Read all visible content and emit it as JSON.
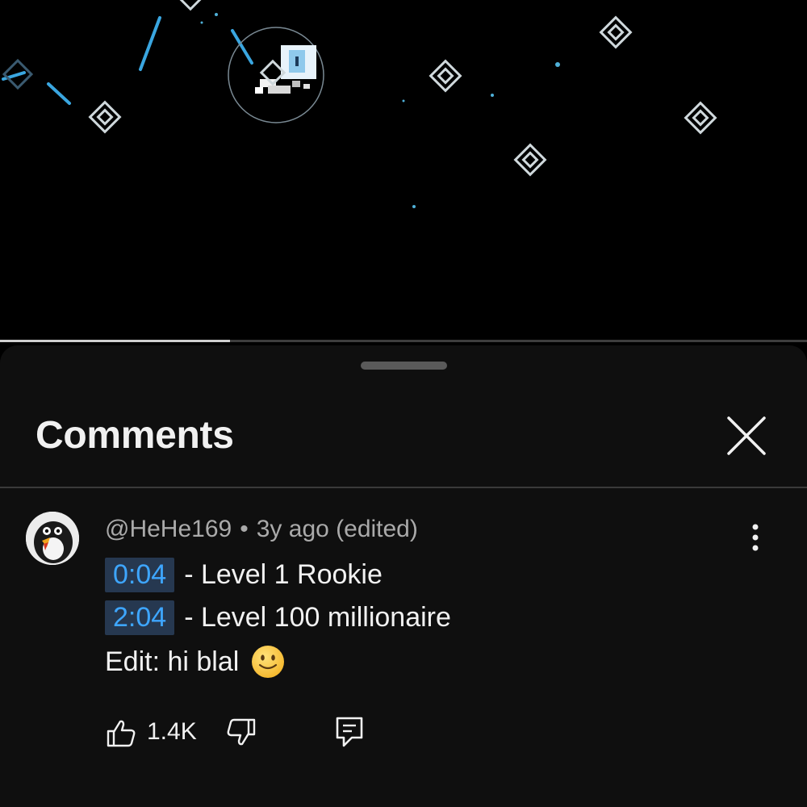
{
  "video": {
    "progress": 0.285,
    "colors": {
      "background": "#000000",
      "accent": "#3aa6e0",
      "outline": "#cfd8dc"
    }
  },
  "comments_panel": {
    "title": "Comments",
    "close_icon": "close-icon",
    "comment": {
      "author": "@HeHe169",
      "separator": "•",
      "age": "3y ago (edited)",
      "lines": [
        {
          "timestamp": "0:04",
          "text": "- Level 1 Rookie"
        },
        {
          "timestamp": "2:04",
          "text": "- Level 100 millionaire"
        }
      ],
      "edit_text": "Edit: hi blal",
      "emoji": "slightly-smiling-face",
      "likes": "1.4K",
      "icons": {
        "like": "thumbs-up-icon",
        "dislike": "thumbs-down-icon",
        "reply": "reply-icon",
        "more": "more-vertical-icon"
      }
    },
    "colors": {
      "sheet": "#0f0f0f",
      "timestamp_link": "#3ea6ff",
      "timestamp_bg": "#263850",
      "meta_text": "#aaaaaa"
    }
  }
}
